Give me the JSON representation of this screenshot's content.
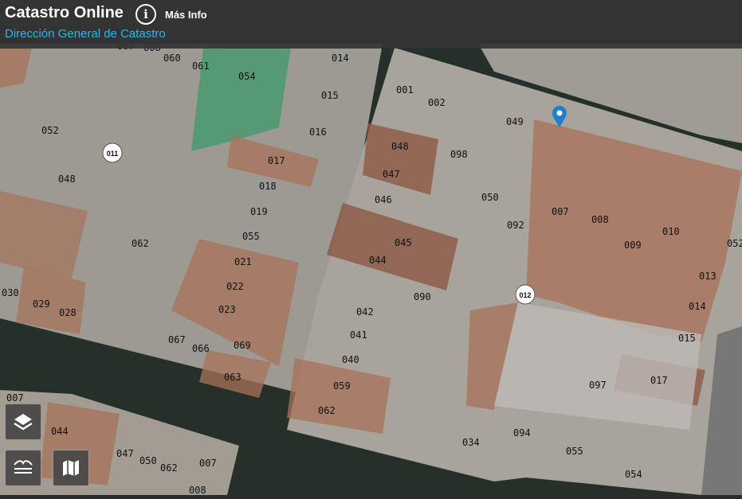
{
  "header": {
    "title": "Catastro Online",
    "subtitle": "Dirección General de Catastro",
    "info_icon": "info-icon",
    "info_label": "Más Info"
  },
  "map": {
    "street_markers": [
      "011",
      "012"
    ],
    "location_marker": "map-pin-icon",
    "parcel_labels": [
      "007",
      "008",
      "060",
      "061",
      "054",
      "014",
      "015",
      "052",
      "011",
      "016",
      "048",
      "017",
      "018",
      "019",
      "062",
      "055",
      "021",
      "022",
      "030",
      "029",
      "028",
      "023",
      "067",
      "066",
      "069",
      "063",
      "007",
      "044",
      "047",
      "050",
      "062",
      "007",
      "008",
      "001",
      "002",
      "049",
      "048",
      "098",
      "047",
      "046",
      "050",
      "092",
      "007",
      "008",
      "010",
      "052",
      "045",
      "044",
      "090",
      "009",
      "013",
      "042",
      "014",
      "041",
      "015",
      "040",
      "097",
      "017",
      "059",
      "062",
      "034",
      "094",
      "055",
      "054"
    ]
  },
  "controls": {
    "layers_icon": "layers-icon",
    "opacity_icon": "opacity-icon",
    "basemap_icon": "map-icon"
  }
}
